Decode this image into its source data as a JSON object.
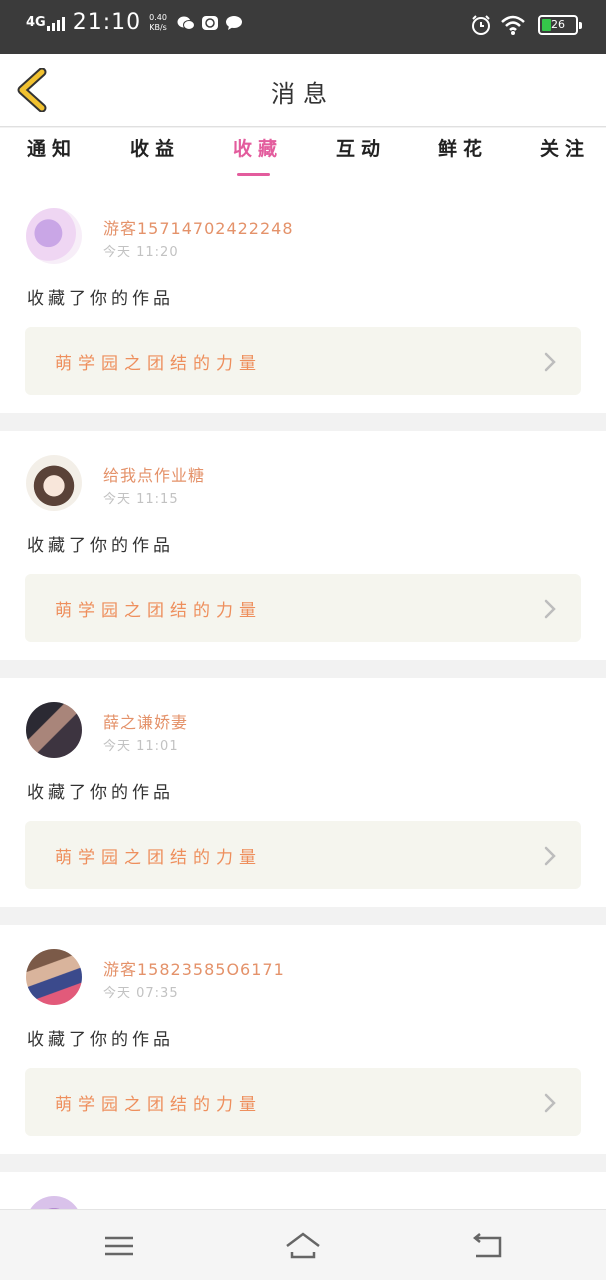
{
  "status_bar": {
    "network": "4G",
    "time": "21:10",
    "speed_value": "0.40",
    "speed_unit": "KB/s",
    "battery": "26",
    "battery_color": "#35c74a",
    "icons": [
      "signal-icon",
      "wechat-icon",
      "qq-icon",
      "message-icon",
      "alarm-icon",
      "wifi-icon",
      "battery-icon"
    ]
  },
  "header": {
    "title": "消息",
    "back_icon": "back-chevron-icon",
    "back_color": "#f2c230"
  },
  "tabs": {
    "items": [
      "通知",
      "收益",
      "收藏",
      "互动",
      "鲜花",
      "关注"
    ],
    "active_index": 2,
    "active_color": "#e35c9d"
  },
  "feed": {
    "items": [
      {
        "username": "游客15714702422248",
        "time": "今天 11:20",
        "action": "收藏了你的作品",
        "work_title": "萌学园之团结的力量"
      },
      {
        "username": "给我点作业糖",
        "time": "今天 11:15",
        "action": "收藏了你的作品",
        "work_title": "萌学园之团结的力量"
      },
      {
        "username": "薛之谦娇妻",
        "time": "今天 11:01",
        "action": "收藏了你的作品",
        "work_title": "萌学园之团结的力量"
      },
      {
        "username": "游客15823585O6171",
        "time": "今天 07:35",
        "action": "收藏了你的作品",
        "work_title": "萌学园之团结的力量"
      }
    ],
    "name_color": "#e4926a",
    "work_color": "#ee8f5d"
  },
  "nav_bar": {
    "icons": [
      "menu-icon",
      "home-icon",
      "back-icon"
    ]
  }
}
